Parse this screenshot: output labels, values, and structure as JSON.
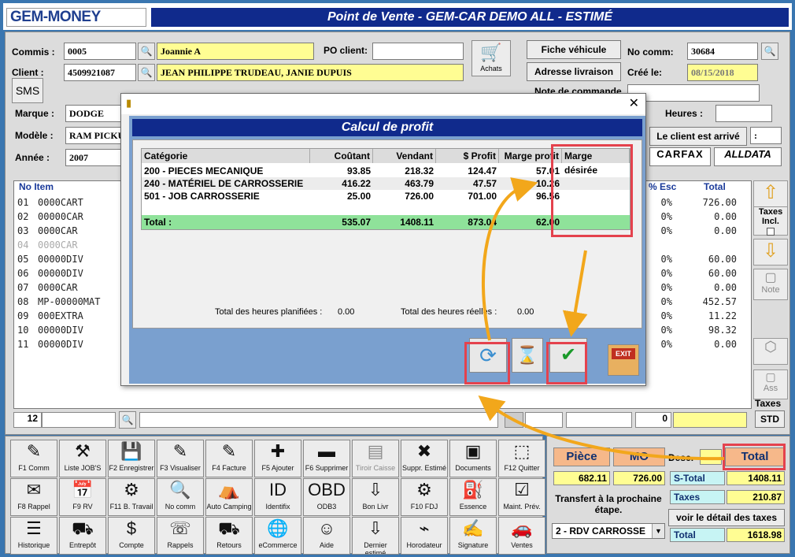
{
  "app": {
    "logo": "GEM-MONEY",
    "title": "Point de Vente - GEM-CAR DEMO ALL  - ESTIMÉ"
  },
  "form": {
    "commis_label": "Commis :",
    "commis_code": "0005",
    "commis_name": "Joannie A",
    "po_label": "PO client:",
    "po_value": "",
    "client_label": "Client :",
    "client_code": "4509921087",
    "client_name": "JEAN PHILIPPE TRUDEAU, JANIE DUPUIS",
    "achats_label": "Achats",
    "sms_label": "SMS",
    "fiche_btn": "Fiche véhicule",
    "adresse_btn": "Adresse livraison",
    "nocomm_label": "No comm:",
    "nocomm_value": "30684",
    "cree_label": "Créé le:",
    "cree_value": "08/15/2018",
    "note_label": "Note de commande",
    "marque_label": "Marque :",
    "marque_value": "DODGE",
    "modele_label": "Modèle :",
    "modele_value": "RAM PICKU",
    "annee_label": "Année :",
    "annee_value": "2007",
    "heures_label": "Heures :",
    "heures_value": "",
    "arrive_btn": "Le client est arrivé",
    "arrive_value": ":",
    "carfax": "CARFAX",
    "alldata": "ALLDATA"
  },
  "grid": {
    "headers": {
      "no_item": "No Item",
      "esc": "% Esc",
      "total": "Total"
    },
    "rows": [
      {
        "n": "01",
        "item": "0000CART",
        "esc": "0%",
        "total": "726.00",
        "dim": false
      },
      {
        "n": "02",
        "item": "00000CAR",
        "esc": "0%",
        "total": "0.00",
        "dim": false
      },
      {
        "n": "03",
        "item": "0000CAR",
        "esc": "0%",
        "total": "0.00",
        "dim": false
      },
      {
        "n": "04",
        "item": "0000CAR",
        "esc": "",
        "total": "",
        "dim": true
      },
      {
        "n": "05",
        "item": "00000DIV",
        "esc": "0%",
        "total": "60.00",
        "dim": false
      },
      {
        "n": "06",
        "item": "00000DIV",
        "esc": "0%",
        "total": "60.00",
        "dim": false
      },
      {
        "n": "07",
        "item": "0000CAR",
        "esc": "0%",
        "total": "0.00",
        "dim": false
      },
      {
        "n": "08",
        "item": "MP-00000MAT",
        "esc": "0%",
        "total": "452.57",
        "dim": false
      },
      {
        "n": "09",
        "item": "000EXTRA",
        "esc": "0%",
        "total": "11.22",
        "dim": false
      },
      {
        "n": "10",
        "item": "00000DIV",
        "esc": "0%",
        "total": "98.32",
        "dim": false
      },
      {
        "n": "11",
        "item": "00000DIV",
        "esc": "0%",
        "total": "0.00",
        "dim": false
      }
    ],
    "taxes_incl": "Taxes Incl.",
    "note": "Note",
    "ass": "Ass",
    "taxes": "Taxes",
    "std": "STD",
    "bottom_count": "12",
    "bottom_zero": "0"
  },
  "dialog": {
    "title": "Calcul de profit",
    "headers": [
      "Catégorie",
      "Coûtant",
      "Vendant",
      "$ Profit",
      "Marge profit",
      "Marge désirée"
    ],
    "rows": [
      [
        "200 - PIECES MECANIQUE",
        "93.85",
        "218.32",
        "124.47",
        "57.01",
        ""
      ],
      [
        "240 - MATÉRIEL DE CARROSSERIE",
        "416.22",
        "463.79",
        "47.57",
        "10.26",
        ""
      ],
      [
        "501 - JOB CARROSSERIE",
        "25.00",
        "726.00",
        "701.00",
        "96.56",
        ""
      ]
    ],
    "total_row": [
      "Total :",
      "535.07",
      "1408.11",
      "873.04",
      "62.00",
      ""
    ],
    "planned_label": "Total des heures planifiées :",
    "planned_value": "0.00",
    "real_label": "Total des heures réelles :",
    "real_value": "0.00",
    "exit": "EXIT"
  },
  "toolbar": [
    {
      "label": "F1 Comm",
      "icon": "✎",
      "name": "f1-comm-button"
    },
    {
      "label": "Liste JOB'S",
      "icon": "⚒",
      "name": "liste-jobs-button"
    },
    {
      "label": "F2 Enregistrer",
      "icon": "💾",
      "name": "f2-enregistrer-button"
    },
    {
      "label": "F3 Visualiser",
      "icon": "✎",
      "name": "f3-visualiser-button"
    },
    {
      "label": "F4 Facture",
      "icon": "✎",
      "name": "f4-facture-button"
    },
    {
      "label": "F5 Ajouter",
      "icon": "✚",
      "name": "f5-ajouter-button"
    },
    {
      "label": "F6 Supprimer",
      "icon": "▬",
      "name": "f6-supprimer-button"
    },
    {
      "label": "Tiroir Caisse",
      "icon": "▤",
      "name": "tiroir-caisse-button",
      "dis": true
    },
    {
      "label": "Suppr. Estimé",
      "icon": "✖",
      "name": "suppr-estime-button"
    },
    {
      "label": "Documents",
      "icon": "▣",
      "name": "documents-button"
    },
    {
      "label": "F12 Quitter",
      "icon": "⬚",
      "name": "f12-quitter-button"
    },
    {
      "label": "F8 Rappel",
      "icon": "✉",
      "name": "f8-rappel-button"
    },
    {
      "label": "F9 RV",
      "icon": "📅",
      "name": "f9-rv-button"
    },
    {
      "label": "F11 B. Travail",
      "icon": "⚙",
      "name": "f11-bon-travail-button"
    },
    {
      "label": "No comm",
      "icon": "🔍",
      "name": "no-comm-button"
    },
    {
      "label": "Auto Camping",
      "icon": "⛺",
      "name": "auto-camping-button"
    },
    {
      "label": "Identifix",
      "icon": "ID",
      "name": "identifix-button"
    },
    {
      "label": "ODB3",
      "icon": "OBD",
      "name": "odb3-button"
    },
    {
      "label": "Bon Livr",
      "icon": "⇩",
      "name": "bon-livr-button"
    },
    {
      "label": "F10 FDJ",
      "icon": "⚙",
      "name": "f10-fdj-button"
    },
    {
      "label": "Essence",
      "icon": "⛽",
      "name": "essence-button"
    },
    {
      "label": "Maint. Prév.",
      "icon": "☑",
      "name": "maint-prev-button"
    },
    {
      "label": "Historique",
      "icon": "☰",
      "name": "historique-button"
    },
    {
      "label": "Entrepôt",
      "icon": "⛟",
      "name": "entrepot-button"
    },
    {
      "label": "Compte",
      "icon": "$",
      "name": "compte-button"
    },
    {
      "label": "Rappels",
      "icon": "☏",
      "name": "rappels-button"
    },
    {
      "label": "Retours",
      "icon": "⛟",
      "name": "retours-button"
    },
    {
      "label": "eCommerce",
      "icon": "🌐",
      "name": "ecommerce-button"
    },
    {
      "label": "Aide",
      "icon": "☺",
      "name": "aide-button"
    },
    {
      "label": "Dernier estimé",
      "icon": "⇩",
      "name": "dernier-estime-button"
    },
    {
      "label": "Horodateur",
      "icon": "⌁",
      "name": "horodateur-button"
    },
    {
      "label": "Signature",
      "icon": "✍",
      "name": "signature-button"
    },
    {
      "label": "Ventes",
      "icon": "🚗",
      "name": "ventes-button"
    }
  ],
  "totals": {
    "piece_label": "Pièce",
    "mo_label": "MO",
    "desc_label": "Desc.",
    "total_label": "Total",
    "piece_value": "682.11",
    "mo_value": "726.00",
    "stotal_label": "S-Total",
    "stotal_value": "1408.11",
    "taxes_label": "Taxes",
    "taxes_value": "210.87",
    "transfer_label": "Transfert à la prochaine étape.",
    "detail_btn": "voir le détail des taxes",
    "step_value": "2 - RDV CARROSSE",
    "total2_label": "Total",
    "total2_value": "1618.98"
  },
  "colors": {
    "accent": "#102a8c",
    "highlight": "#e4424d",
    "arrow": "#f2a71b",
    "yellow_field": "#fffd93",
    "green_row": "#8fe29a"
  }
}
